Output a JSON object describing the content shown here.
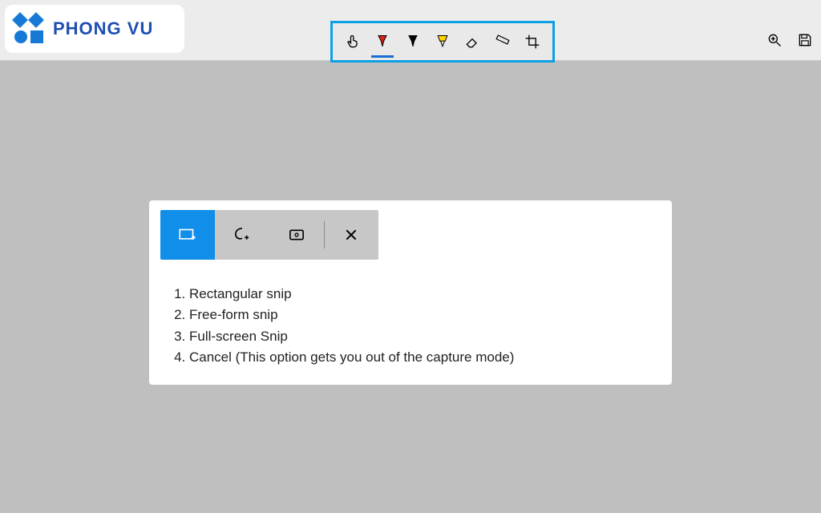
{
  "brand": {
    "name": "PHONG VU"
  },
  "toolbar": {
    "tools": [
      {
        "name": "touch-tool",
        "selected": false
      },
      {
        "name": "pen-red-tool",
        "selected": true
      },
      {
        "name": "pen-black-tool",
        "selected": false
      },
      {
        "name": "highlighter-tool",
        "selected": false
      },
      {
        "name": "eraser-tool",
        "selected": false
      },
      {
        "name": "ruler-tool",
        "selected": false
      },
      {
        "name": "crop-tool",
        "selected": false
      }
    ]
  },
  "rightTools": {
    "zoom": "zoom-tool",
    "save": "save-tool"
  },
  "snipBar": {
    "buttons": [
      {
        "name": "rectangular-snip-button",
        "primary": true
      },
      {
        "name": "freeform-snip-button",
        "primary": false
      },
      {
        "name": "fullscreen-snip-button",
        "primary": false
      },
      {
        "name": "close-snip-button",
        "primary": false,
        "divider": true
      }
    ]
  },
  "snipList": {
    "items": [
      "Rectangular snip",
      "Free-form snip",
      "Full-screen Snip",
      "Cancel (This option gets you out of the capture mode)"
    ]
  }
}
